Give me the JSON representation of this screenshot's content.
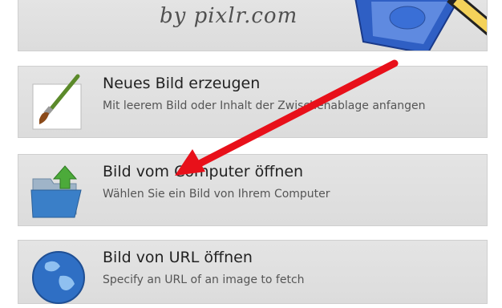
{
  "header": {
    "tagline": "by pixlr.com"
  },
  "options": [
    {
      "title": "Neues Bild erzeugen",
      "description": "Mit leerem Bild oder Inhalt der Zwischenablage anfangen",
      "icon": "paintbrush-icon"
    },
    {
      "title": "Bild vom Computer öffnen",
      "description": "Wählen Sie ein Bild von Ihrem Computer",
      "icon": "folder-upload-icon"
    },
    {
      "title": "Bild von URL öffnen",
      "description": "Specify an URL of an image to fetch",
      "icon": "globe-icon"
    }
  ],
  "colors": {
    "panel": "#e0e0e0",
    "annotation_arrow": "#e8101a",
    "title_text": "#222222",
    "desc_text": "#555555"
  }
}
